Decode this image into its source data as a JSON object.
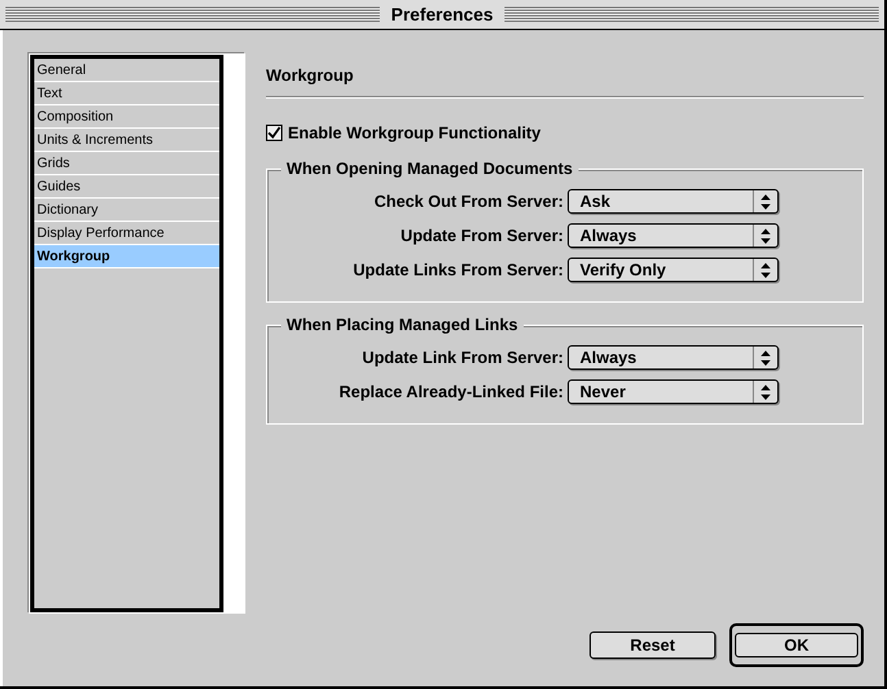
{
  "window": {
    "title": "Preferences"
  },
  "sidebar": {
    "items": [
      {
        "label": "General",
        "selected": false
      },
      {
        "label": "Text",
        "selected": false
      },
      {
        "label": "Composition",
        "selected": false
      },
      {
        "label": "Units & Increments",
        "selected": false
      },
      {
        "label": "Grids",
        "selected": false
      },
      {
        "label": "Guides",
        "selected": false
      },
      {
        "label": "Dictionary",
        "selected": false
      },
      {
        "label": "Display Performance",
        "selected": false
      },
      {
        "label": "Workgroup",
        "selected": true
      }
    ]
  },
  "panel": {
    "title": "Workgroup",
    "checkbox": {
      "label": "Enable Workgroup Functionality",
      "checked": true
    },
    "groups": [
      {
        "title": "When Opening Managed Documents",
        "rows": [
          {
            "label": "Check Out From Server:",
            "value": "Ask"
          },
          {
            "label": "Update From Server:",
            "value": "Always"
          },
          {
            "label": "Update Links From Server:",
            "value": "Verify Only"
          }
        ]
      },
      {
        "title": "When Placing Managed Links",
        "rows": [
          {
            "label": "Update Link From Server:",
            "value": "Always"
          },
          {
            "label": "Replace Already-Linked File:",
            "value": "Never"
          }
        ]
      }
    ]
  },
  "buttons": [
    {
      "label": "Reset",
      "default": false
    },
    {
      "label": "OK",
      "default": true
    }
  ]
}
